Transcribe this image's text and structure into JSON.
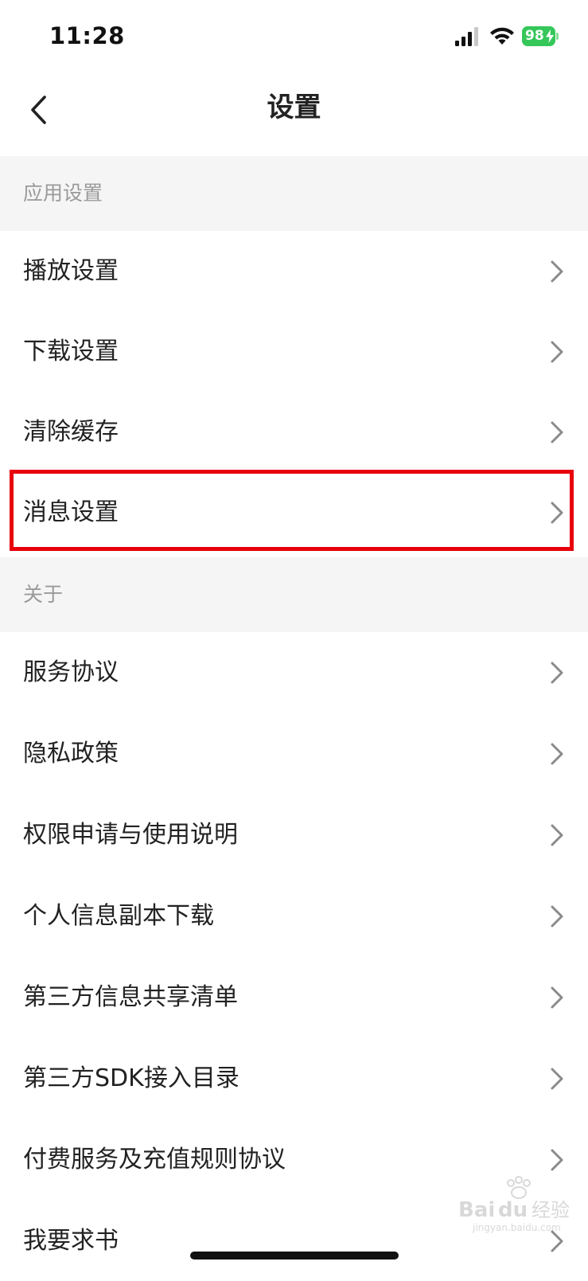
{
  "status_bar": {
    "time": "11:28",
    "battery": "98"
  },
  "nav": {
    "title": "设置"
  },
  "sections": [
    {
      "header": "应用设置",
      "items": [
        {
          "label": "播放设置"
        },
        {
          "label": "下载设置"
        },
        {
          "label": "清除缓存"
        },
        {
          "label": "消息设置"
        }
      ]
    },
    {
      "header": "关于",
      "items": [
        {
          "label": "服务协议"
        },
        {
          "label": "隐私政策"
        },
        {
          "label": "权限申请与使用说明"
        },
        {
          "label": "个人信息副本下载"
        },
        {
          "label": "第三方信息共享清单"
        },
        {
          "label": "第三方SDK接入目录"
        },
        {
          "label": "付费服务及充值规则协议"
        },
        {
          "label": "我要求书"
        }
      ]
    }
  ],
  "watermark": {
    "brand": "Bai du",
    "cn": "经验",
    "url": "jingyan.baidu.com"
  },
  "colors": {
    "section_bg": "#f5f5f5",
    "highlight": "#e8000b",
    "battery": "#35c759"
  }
}
